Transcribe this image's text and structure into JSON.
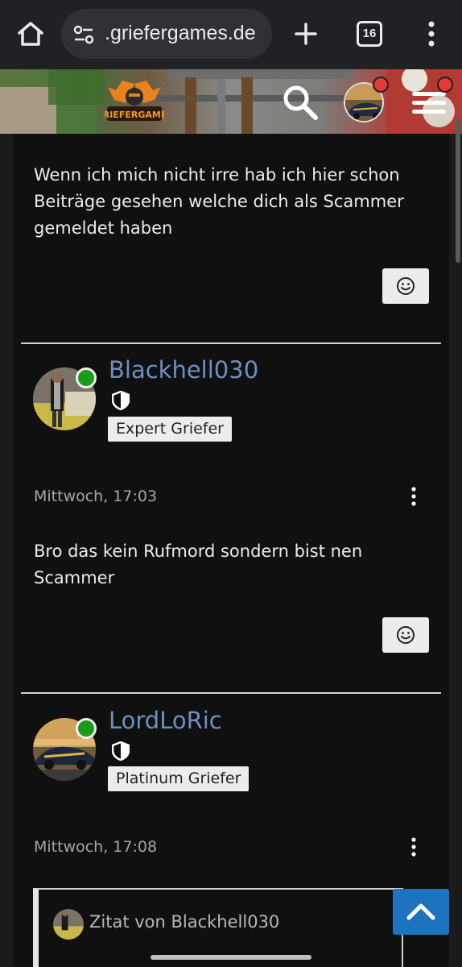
{
  "browser": {
    "url": ".griefergames.de",
    "tab_count": "16"
  },
  "site": {
    "logo_text": "GRIEFERGAMES"
  },
  "posts": [
    {
      "text": "Wenn ich mich nicht irre hab ich hier schon Beiträge gesehen welche dich als Scammer gemeldet haben"
    },
    {
      "username": "Blackhell030",
      "rank": "Expert Griefer",
      "date": "Mittwoch, 17:03",
      "text": "Bro das kein Rufmord sondern bist nen Scammer"
    },
    {
      "username": "LordLoRic",
      "rank": "Platinum Griefer",
      "date": "Mittwoch, 17:08",
      "quote_label": "Zitat von Blackhell030"
    }
  ],
  "colors": {
    "username": "#6f8fbf",
    "online": "#1a9b1a",
    "notification": "#e53935",
    "scroll_top": "#1e73be"
  },
  "icons": [
    "home-icon",
    "site-info-icon",
    "plus-icon",
    "tabs-icon",
    "more-vert-icon",
    "search-icon",
    "hamburger-icon",
    "smiley-icon",
    "shield-icon",
    "chevron-up-icon"
  ]
}
